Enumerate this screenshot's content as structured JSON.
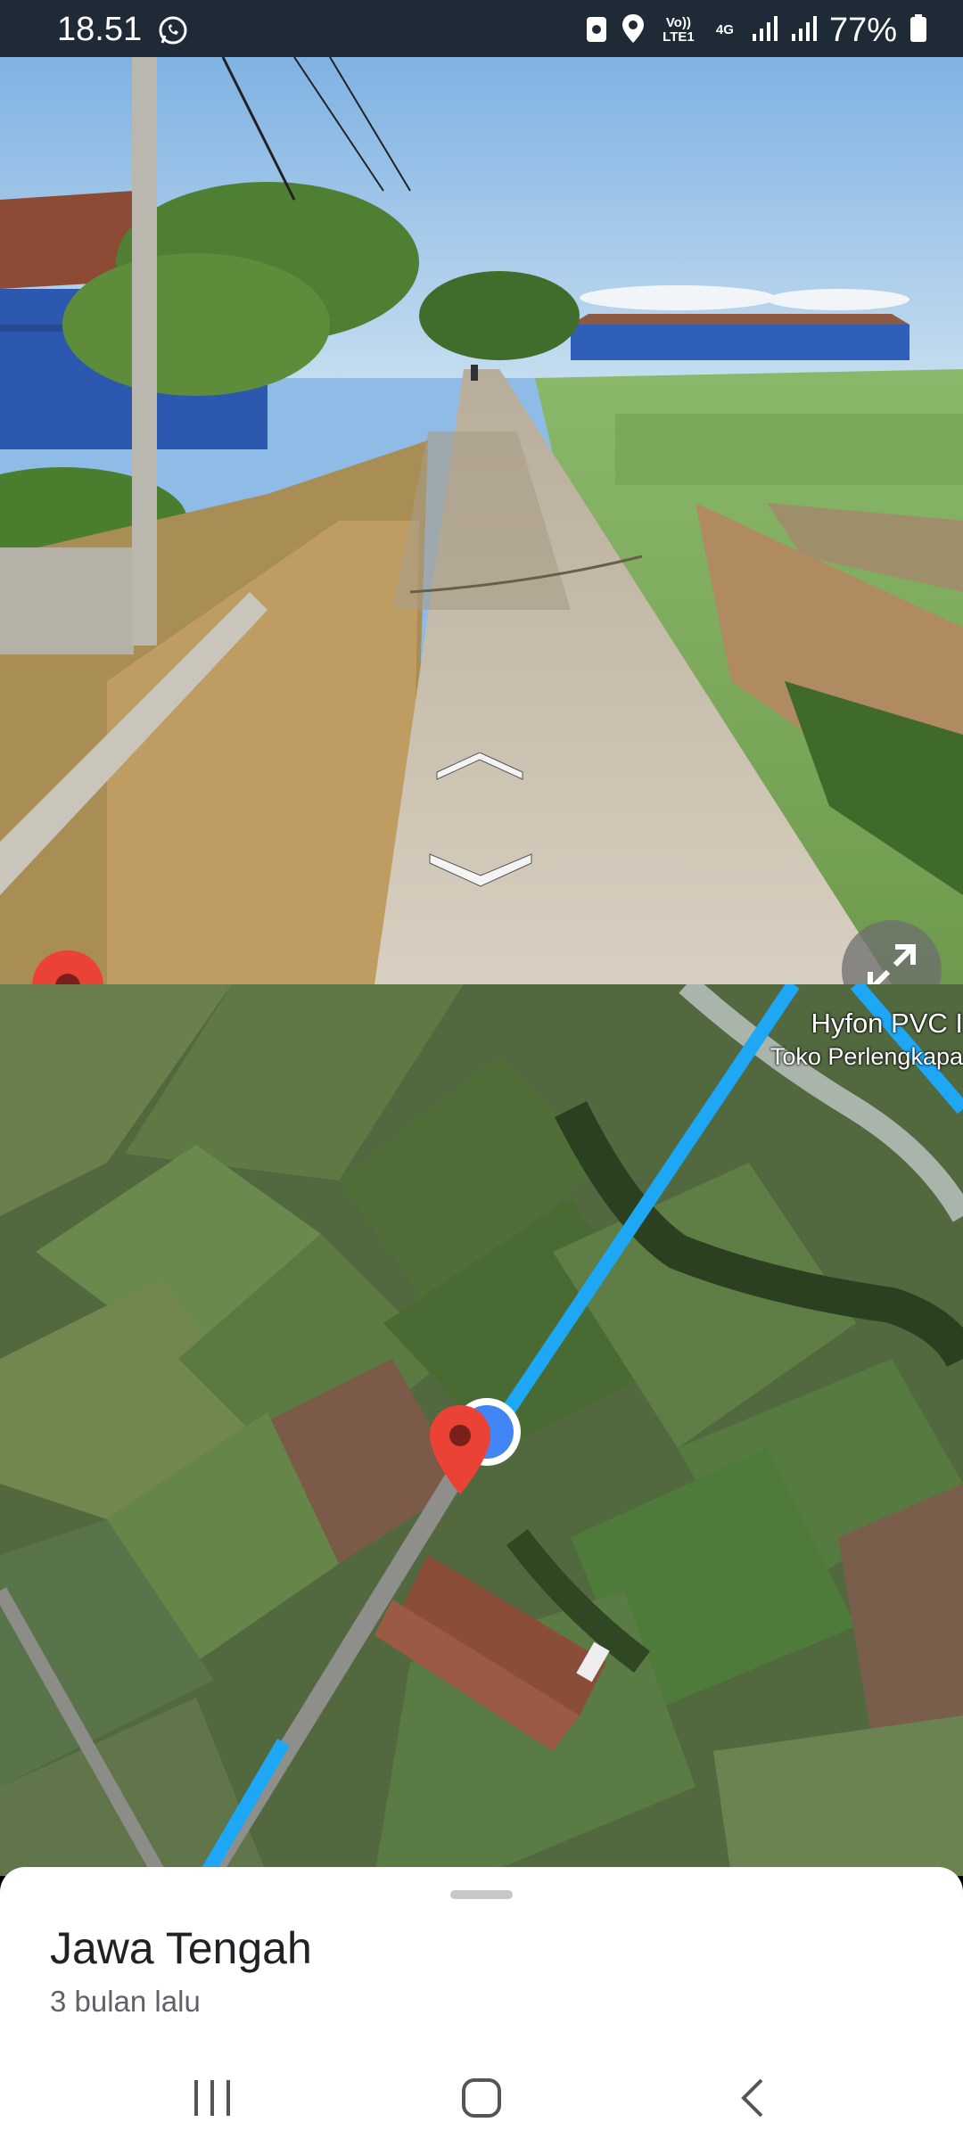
{
  "status_bar": {
    "time": "18.51",
    "volte": "Vo)) LTE1",
    "network": "4G",
    "battery": "77%",
    "icons": [
      "whatsapp-icon",
      "recycle-app-icon",
      "location-icon",
      "volte-icon",
      "signal-icon",
      "signal-icon",
      "battery-icon"
    ]
  },
  "street_view": {
    "controls": [
      "chevron-up-icon",
      "chevron-down-icon",
      "expand-icon",
      "red-pin-icon"
    ]
  },
  "map": {
    "poi_title": "Hyfon PVC I",
    "poi_subtitle": "Toko Perlengkapa",
    "route_color": "#1ea7f4",
    "pin_color": "#ea4335"
  },
  "place": {
    "title": "Jawa Tengah",
    "date": "3 bulan lalu"
  },
  "nav": [
    "recent-apps-icon",
    "home-icon",
    "back-icon"
  ]
}
